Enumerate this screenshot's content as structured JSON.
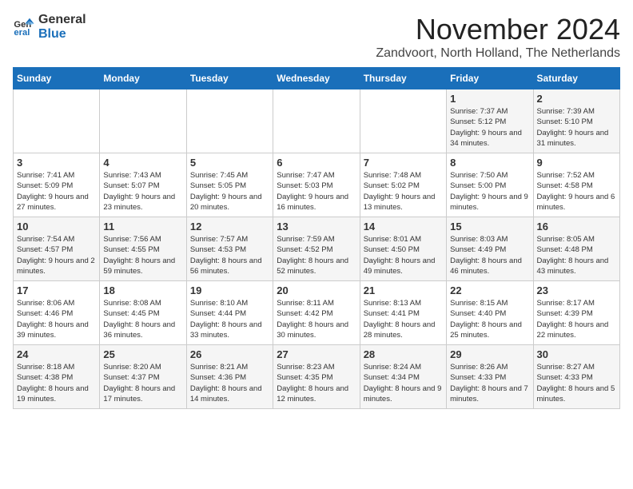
{
  "logo": {
    "text_general": "General",
    "text_blue": "Blue"
  },
  "title": "November 2024",
  "location": "Zandvoort, North Holland, The Netherlands",
  "days_of_week": [
    "Sunday",
    "Monday",
    "Tuesday",
    "Wednesday",
    "Thursday",
    "Friday",
    "Saturday"
  ],
  "weeks": [
    [
      {
        "day": "",
        "info": ""
      },
      {
        "day": "",
        "info": ""
      },
      {
        "day": "",
        "info": ""
      },
      {
        "day": "",
        "info": ""
      },
      {
        "day": "",
        "info": ""
      },
      {
        "day": "1",
        "info": "Sunrise: 7:37 AM\nSunset: 5:12 PM\nDaylight: 9 hours and 34 minutes."
      },
      {
        "day": "2",
        "info": "Sunrise: 7:39 AM\nSunset: 5:10 PM\nDaylight: 9 hours and 31 minutes."
      }
    ],
    [
      {
        "day": "3",
        "info": "Sunrise: 7:41 AM\nSunset: 5:09 PM\nDaylight: 9 hours and 27 minutes."
      },
      {
        "day": "4",
        "info": "Sunrise: 7:43 AM\nSunset: 5:07 PM\nDaylight: 9 hours and 23 minutes."
      },
      {
        "day": "5",
        "info": "Sunrise: 7:45 AM\nSunset: 5:05 PM\nDaylight: 9 hours and 20 minutes."
      },
      {
        "day": "6",
        "info": "Sunrise: 7:47 AM\nSunset: 5:03 PM\nDaylight: 9 hours and 16 minutes."
      },
      {
        "day": "7",
        "info": "Sunrise: 7:48 AM\nSunset: 5:02 PM\nDaylight: 9 hours and 13 minutes."
      },
      {
        "day": "8",
        "info": "Sunrise: 7:50 AM\nSunset: 5:00 PM\nDaylight: 9 hours and 9 minutes."
      },
      {
        "day": "9",
        "info": "Sunrise: 7:52 AM\nSunset: 4:58 PM\nDaylight: 9 hours and 6 minutes."
      }
    ],
    [
      {
        "day": "10",
        "info": "Sunrise: 7:54 AM\nSunset: 4:57 PM\nDaylight: 9 hours and 2 minutes."
      },
      {
        "day": "11",
        "info": "Sunrise: 7:56 AM\nSunset: 4:55 PM\nDaylight: 8 hours and 59 minutes."
      },
      {
        "day": "12",
        "info": "Sunrise: 7:57 AM\nSunset: 4:53 PM\nDaylight: 8 hours and 56 minutes."
      },
      {
        "day": "13",
        "info": "Sunrise: 7:59 AM\nSunset: 4:52 PM\nDaylight: 8 hours and 52 minutes."
      },
      {
        "day": "14",
        "info": "Sunrise: 8:01 AM\nSunset: 4:50 PM\nDaylight: 8 hours and 49 minutes."
      },
      {
        "day": "15",
        "info": "Sunrise: 8:03 AM\nSunset: 4:49 PM\nDaylight: 8 hours and 46 minutes."
      },
      {
        "day": "16",
        "info": "Sunrise: 8:05 AM\nSunset: 4:48 PM\nDaylight: 8 hours and 43 minutes."
      }
    ],
    [
      {
        "day": "17",
        "info": "Sunrise: 8:06 AM\nSunset: 4:46 PM\nDaylight: 8 hours and 39 minutes."
      },
      {
        "day": "18",
        "info": "Sunrise: 8:08 AM\nSunset: 4:45 PM\nDaylight: 8 hours and 36 minutes."
      },
      {
        "day": "19",
        "info": "Sunrise: 8:10 AM\nSunset: 4:44 PM\nDaylight: 8 hours and 33 minutes."
      },
      {
        "day": "20",
        "info": "Sunrise: 8:11 AM\nSunset: 4:42 PM\nDaylight: 8 hours and 30 minutes."
      },
      {
        "day": "21",
        "info": "Sunrise: 8:13 AM\nSunset: 4:41 PM\nDaylight: 8 hours and 28 minutes."
      },
      {
        "day": "22",
        "info": "Sunrise: 8:15 AM\nSunset: 4:40 PM\nDaylight: 8 hours and 25 minutes."
      },
      {
        "day": "23",
        "info": "Sunrise: 8:17 AM\nSunset: 4:39 PM\nDaylight: 8 hours and 22 minutes."
      }
    ],
    [
      {
        "day": "24",
        "info": "Sunrise: 8:18 AM\nSunset: 4:38 PM\nDaylight: 8 hours and 19 minutes."
      },
      {
        "day": "25",
        "info": "Sunrise: 8:20 AM\nSunset: 4:37 PM\nDaylight: 8 hours and 17 minutes."
      },
      {
        "day": "26",
        "info": "Sunrise: 8:21 AM\nSunset: 4:36 PM\nDaylight: 8 hours and 14 minutes."
      },
      {
        "day": "27",
        "info": "Sunrise: 8:23 AM\nSunset: 4:35 PM\nDaylight: 8 hours and 12 minutes."
      },
      {
        "day": "28",
        "info": "Sunrise: 8:24 AM\nSunset: 4:34 PM\nDaylight: 8 hours and 9 minutes."
      },
      {
        "day": "29",
        "info": "Sunrise: 8:26 AM\nSunset: 4:33 PM\nDaylight: 8 hours and 7 minutes."
      },
      {
        "day": "30",
        "info": "Sunrise: 8:27 AM\nSunset: 4:33 PM\nDaylight: 8 hours and 5 minutes."
      }
    ]
  ]
}
